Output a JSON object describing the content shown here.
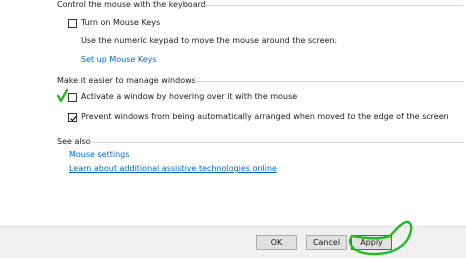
{
  "colors": {
    "link": "#0066cc",
    "footer_bg": "#f0f0f0",
    "button_bg": "#e1e1e1",
    "annotation": "#22bb22"
  },
  "sections": {
    "keyboard": {
      "title": "Control the mouse with the keyboard",
      "mouse_keys": {
        "label": "Turn on Mouse Keys",
        "checked": false
      },
      "description": "Use the numeric keypad to move the mouse around the screen.",
      "setup_link": "Set up Mouse Keys"
    },
    "windows": {
      "title": "Make it easier to manage windows",
      "hover_activate": {
        "label": "Activate a window by hovering over it with the mouse",
        "checked": false
      },
      "prevent_arrange": {
        "label": "Prevent windows from being automatically arranged when moved to the edge of the screen",
        "checked": true
      }
    },
    "see_also": {
      "title": "See also",
      "links": [
        "Mouse settings",
        "Learn about additional assistive technologies online"
      ]
    }
  },
  "footer": {
    "ok_label": "OK",
    "cancel_label": "Cancel",
    "apply_label": "Apply"
  },
  "annotations": {
    "checkmark_icon": "hand-drawn-check-icon",
    "apply_circle_icon": "hand-drawn-circle-icon"
  }
}
